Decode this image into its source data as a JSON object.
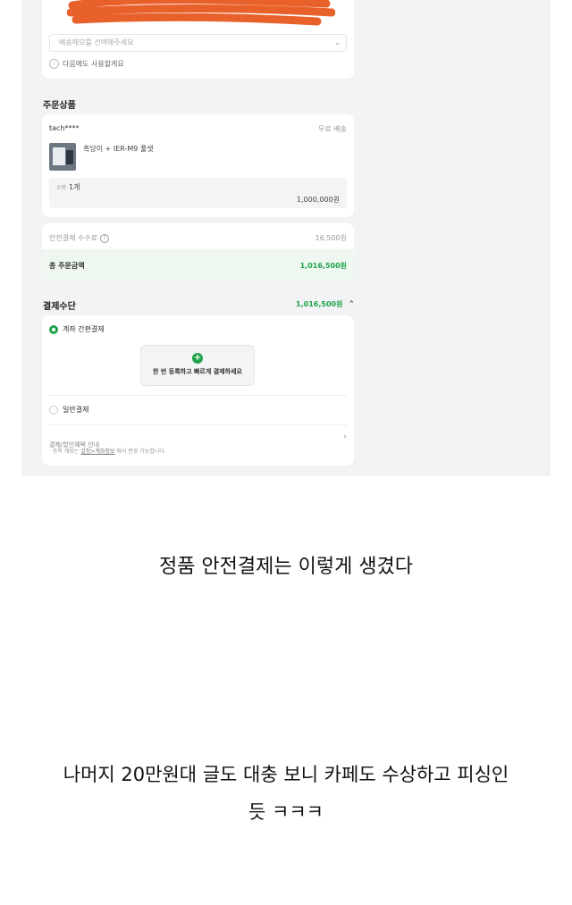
{
  "shipping": {
    "memo_placeholder": "배송메모를 선택해주세요",
    "save_next_label": "다음에도 사용할게요"
  },
  "order": {
    "section_title": "주문상품",
    "seller": "tach****",
    "shipping_fee_label": "무료 배송",
    "product_name": "흑당이 + IER-M9 풀셋",
    "qty_label": "수량",
    "qty_value": "1개",
    "price": "1,000,000원"
  },
  "fees": {
    "safe_fee_label": "안전결제 수수료",
    "safe_fee_value": "16,500원",
    "total_label": "총 주문금액",
    "total_value": "1,016,500원"
  },
  "payment": {
    "section_title": "결제수단",
    "amount": "1,016,500원",
    "option1_label": "계좌 간편결제",
    "register_text": "한 번 등록하고 빠르게 결제하세요",
    "option2_label": "일반결제",
    "benefit_label": "결제/할인혜택 안내",
    "note_prefix": "· 등록 계좌는",
    "note_link": "설정>계좌정보",
    "note_suffix": "에서 변경 가능합니다."
  },
  "captions": {
    "line1": "정품 안전결제는 이렇게 생겼다",
    "line2": "나머지 20만원대 글도 대충 보니 카페도 수상하고 피싱인",
    "line3": "듯 ㅋㅋㅋ"
  },
  "colors": {
    "accent_green": "#1fa34a",
    "redaction": "#e8602a",
    "panel_bg": "#f2f3f5"
  }
}
